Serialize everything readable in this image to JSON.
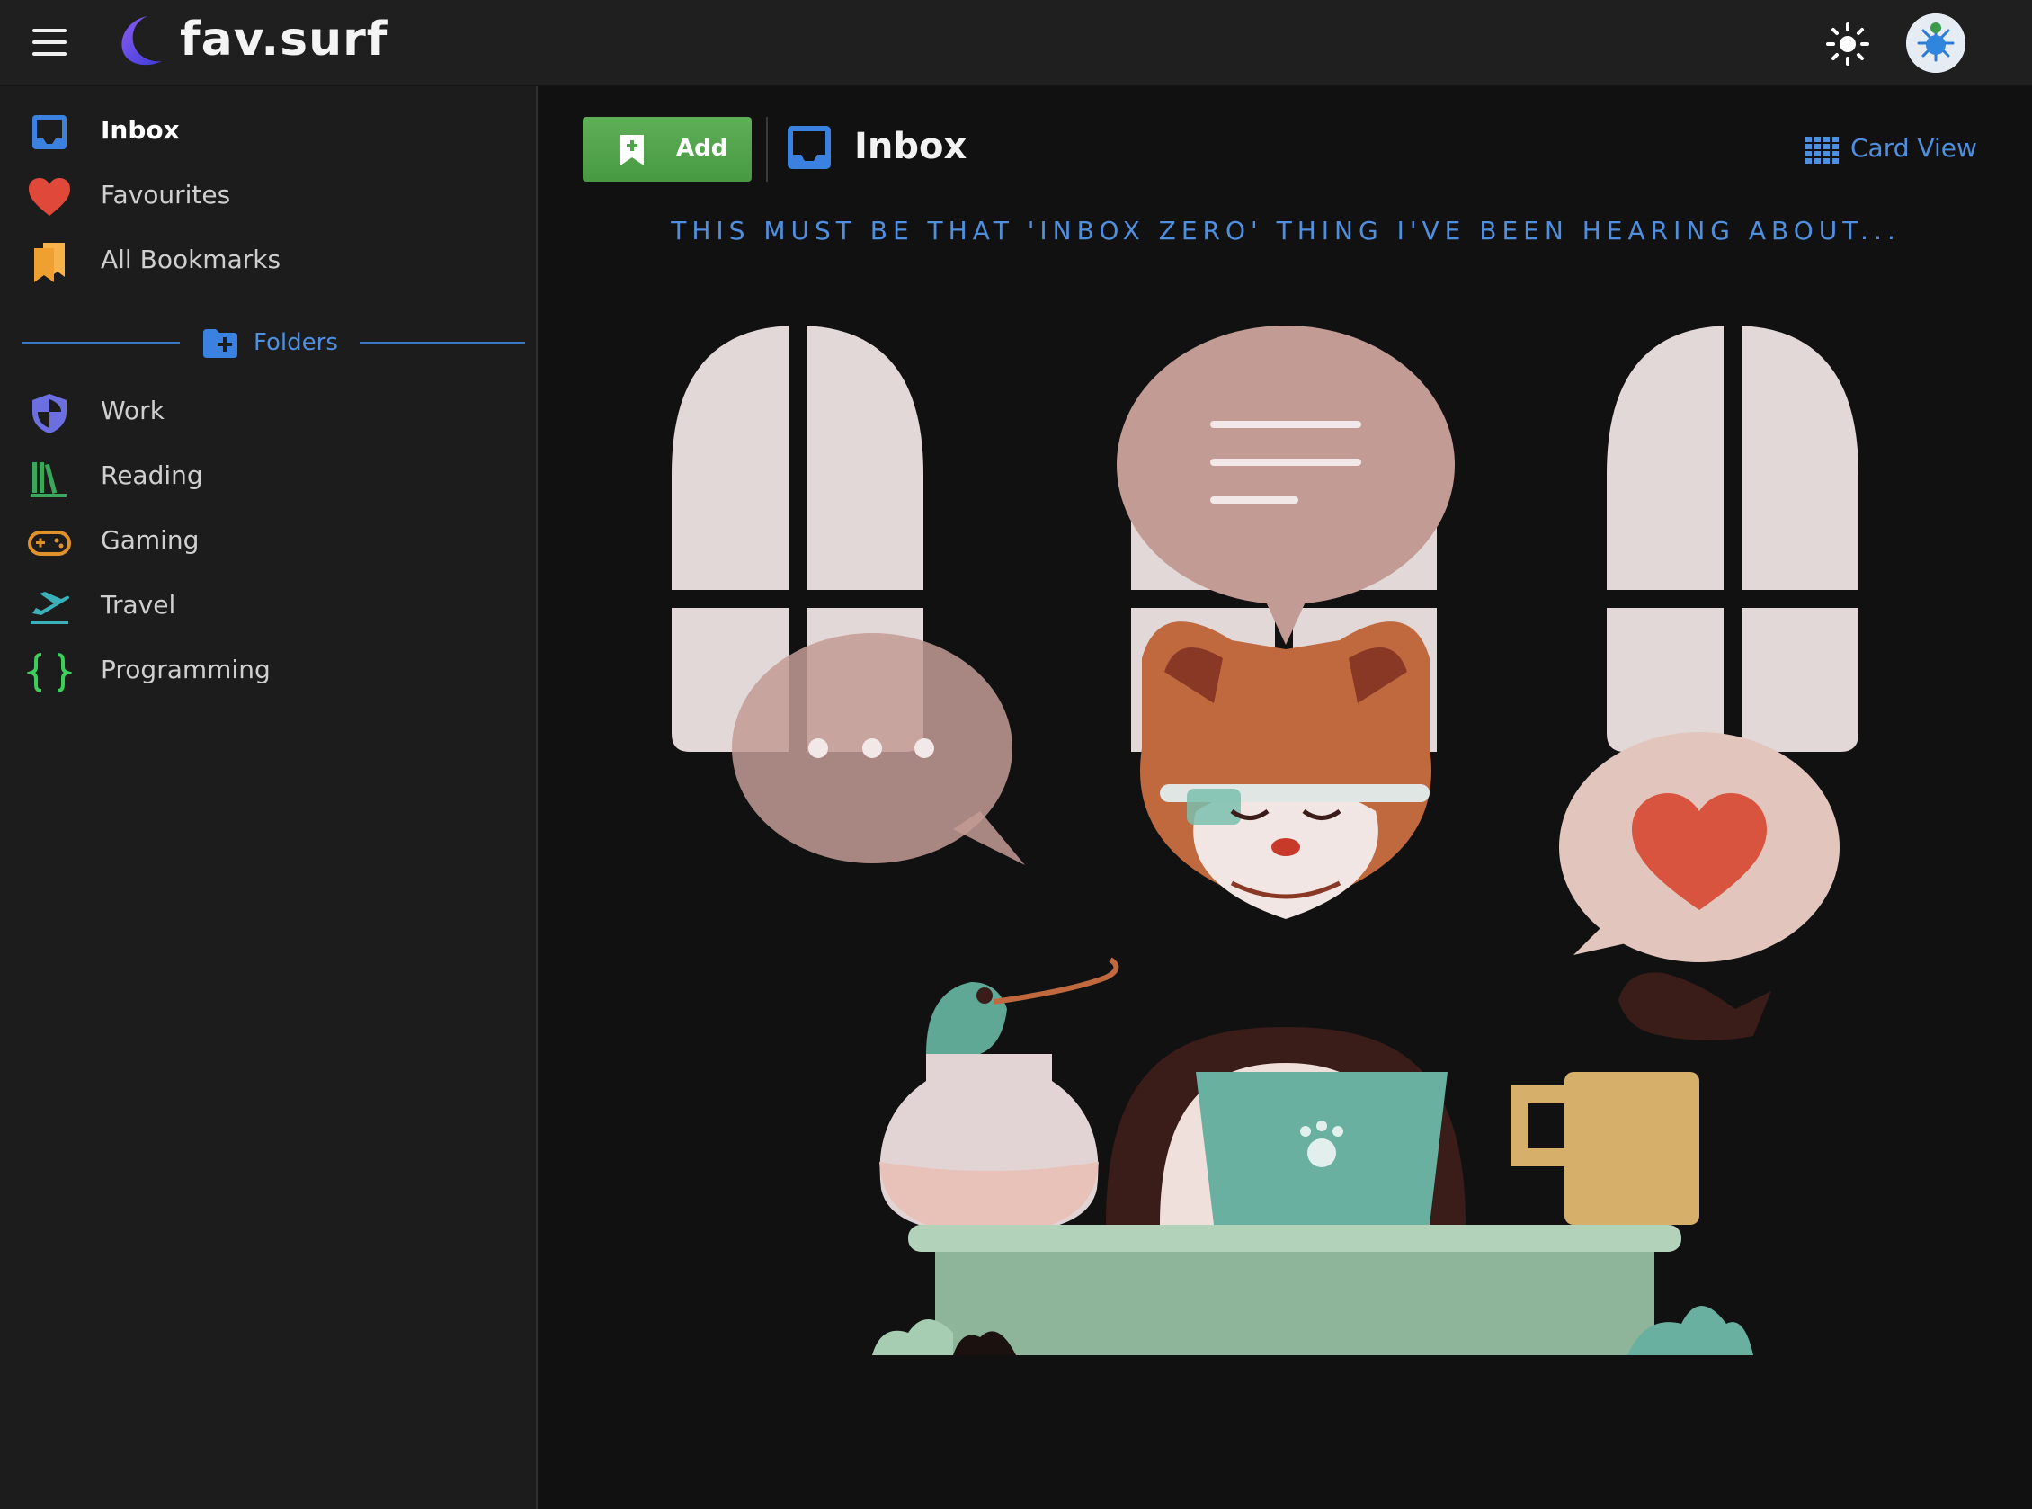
{
  "app": {
    "brand": "fav.surf"
  },
  "header": {
    "menu_icon": "hamburger-icon",
    "theme_icon": "sun-icon",
    "avatar_icon": "avatar"
  },
  "sidebar": {
    "items": [
      {
        "label": "Inbox",
        "icon": "inbox-icon",
        "color": "#3b82e0",
        "active": true
      },
      {
        "label": "Favourites",
        "icon": "heart-icon",
        "color": "#e0483a",
        "active": false
      },
      {
        "label": "All Bookmarks",
        "icon": "bookmarks-icon",
        "color": "#f0a030",
        "active": false
      }
    ],
    "folders_label": "Folders",
    "folders": [
      {
        "label": "Work",
        "icon": "shield-icon",
        "color": "#6b6fe0"
      },
      {
        "label": "Reading",
        "icon": "books-icon",
        "color": "#3aa85a"
      },
      {
        "label": "Gaming",
        "icon": "gamepad-icon",
        "color": "#e0922a"
      },
      {
        "label": "Travel",
        "icon": "plane-departure-icon",
        "color": "#3ab0b8"
      },
      {
        "label": "Programming",
        "icon": "code-braces-icon",
        "color": "#3ad05a"
      }
    ]
  },
  "main": {
    "add_label": "Add",
    "title": "Inbox",
    "view_toggle": "Card View",
    "empty_message": "THIS MUST BE THAT 'INBOX ZERO' THING I'VE BEEN HEARING ABOUT...",
    "accent": "#4f8fe0",
    "add_color": "#52a44c"
  }
}
